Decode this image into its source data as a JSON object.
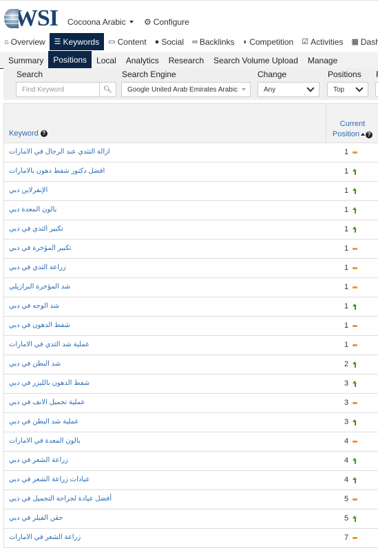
{
  "header": {
    "logo_text": "WSI",
    "account_name": "Cocoona Arabic",
    "configure_label": "Configure"
  },
  "main_nav": [
    {
      "label": "Overview",
      "icon": "home-icon",
      "active": false
    },
    {
      "label": "Keywords",
      "icon": "list-icon",
      "active": true
    },
    {
      "label": "Content",
      "icon": "monitor-icon",
      "active": false
    },
    {
      "label": "Social",
      "icon": "comments-icon",
      "active": false
    },
    {
      "label": "Backlinks",
      "icon": "link-icon",
      "active": false
    },
    {
      "label": "Competition",
      "icon": "shield-icon",
      "active": false
    },
    {
      "label": "Activities",
      "icon": "checkbox-icon",
      "active": false
    },
    {
      "label": "Dashb",
      "icon": "grid-icon",
      "active": false
    }
  ],
  "sub_nav": [
    {
      "label": "Summary",
      "active": false
    },
    {
      "label": "Positions",
      "active": true
    },
    {
      "label": "Local",
      "active": false
    },
    {
      "label": "Analytics",
      "active": false
    },
    {
      "label": "Research",
      "active": false
    },
    {
      "label": "Search Volume Upload",
      "active": false
    },
    {
      "label": "Manage",
      "active": false
    }
  ],
  "filters": {
    "search_label": "Search",
    "search_placeholder": "Find Keyword",
    "search_value": "",
    "engine_label": "Search Engine",
    "engine_value": "Google United Arab Emirates Arabic",
    "change_label": "Change",
    "change_value": "Any",
    "positions_label": "Positions",
    "positions_value": "Top"
  },
  "table": {
    "col_keyword": "Keyword",
    "col_position_line1": "Current",
    "col_position_line2": "Position",
    "rows": [
      {
        "keyword": "ازالة التثدي عند الرجال في الامارات",
        "position": "1",
        "change": "same"
      },
      {
        "keyword": "افضل دكتور شفط دهون بالامارات",
        "position": "1",
        "change": "up"
      },
      {
        "keyword": "الإنفرلاين دبي",
        "position": "1",
        "change": "up"
      },
      {
        "keyword": "بالون المعدة دبي",
        "position": "1",
        "change": "up"
      },
      {
        "keyword": "تكبير الثدي في دبي",
        "position": "1",
        "change": "up"
      },
      {
        "keyword": "تكبير المؤخرة في دبي",
        "position": "1",
        "change": "same"
      },
      {
        "keyword": "زراعة الثدي في دبي",
        "position": "1",
        "change": "same"
      },
      {
        "keyword": "شد المؤخرة البرازيلي",
        "position": "1",
        "change": "same"
      },
      {
        "keyword": "شد الوجه في دبي",
        "position": "1",
        "change": "up"
      },
      {
        "keyword": "شفط الدهون في دبي",
        "position": "1",
        "change": "same"
      },
      {
        "keyword": "عملية شد الثدي في الامارات",
        "position": "1",
        "change": "same"
      },
      {
        "keyword": "شد البطن في دبي",
        "position": "2",
        "change": "up"
      },
      {
        "keyword": "شفط الدهون بالليزر في دبي",
        "position": "3",
        "change": "up"
      },
      {
        "keyword": "عملية تجميل الانف في دبي",
        "position": "3",
        "change": "same"
      },
      {
        "keyword": "عملية شد البطن في دبي",
        "position": "3",
        "change": "up"
      },
      {
        "keyword": "بالون المعدة في الامارات",
        "position": "4",
        "change": "same"
      },
      {
        "keyword": "زراعة الشعر في دبي",
        "position": "4",
        "change": "up"
      },
      {
        "keyword": "عيادات زراعة الشعر في دبي",
        "position": "4",
        "change": "up"
      },
      {
        "keyword": "أفضل عيادة لجراحة التجميل في دبي",
        "position": "5",
        "change": "same"
      },
      {
        "keyword": "حقن الفيلر في دبي",
        "position": "5",
        "change": "up"
      },
      {
        "keyword": "زراعة الشعر في الامارات",
        "position": "7",
        "change": "same"
      }
    ]
  },
  "colors": {
    "nav_active_bg": "#0b2647",
    "link_blue": "#2a6db5",
    "change_same": "#f0942f",
    "change_up": "#4a8d1f"
  }
}
